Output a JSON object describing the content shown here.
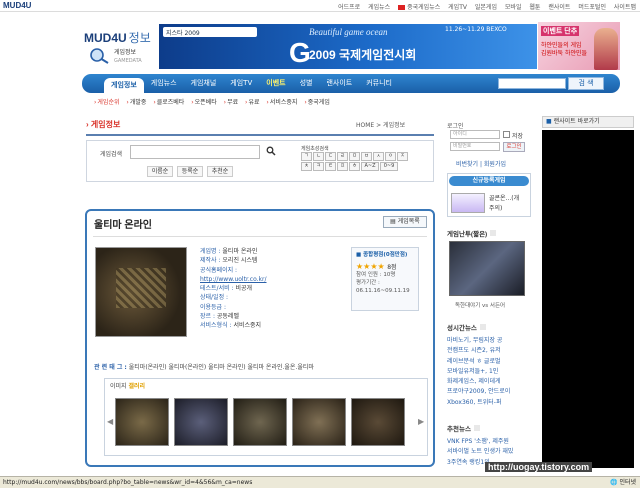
{
  "topbar": {
    "logo": "MUD4U",
    "links": [
      "어드프로",
      "게임뉴스",
      "중국게임뉴스",
      "게임TV",
      "일본게임",
      "모바일",
      "웹툰",
      "랜사이트",
      "머드포털인",
      "사이트맵"
    ]
  },
  "header": {
    "site_title": "MUD4U",
    "site_title_suffix": "정보",
    "game_info_label": "게임정보",
    "game_info_sub": "GAMEDATA"
  },
  "banner": {
    "tag": "지스타 2009",
    "g": "G",
    "year_title": "2009 국제게임전시회",
    "subtitle": "Beautiful game ocean",
    "date": "11.26~11.29  BEXCO"
  },
  "side_ad": {
    "line1": "이벤트 단추",
    "line2": "하얀민들의 게임",
    "line3": "김원바둑 하얀민들"
  },
  "nav": {
    "items": [
      "게임정보",
      "게임뉴스",
      "게임채널",
      "게임TV",
      "이벤트",
      "성별",
      "랜사이트",
      "커뮤니티"
    ],
    "search_button": "검 색"
  },
  "subnav": {
    "items": [
      "게임순위",
      "개발중",
      "클로즈베타",
      "오픈베타",
      "무료",
      "유료",
      "서비스중지",
      "중국게임"
    ]
  },
  "page": {
    "title": "게임정보",
    "breadcrumb": "HOME  >  게임정보"
  },
  "search": {
    "label": "게임검색",
    "sort_buttons": [
      "이름순",
      "등록순",
      "추천순"
    ],
    "initials_label": "게임초성검색",
    "initials": [
      "ㄱ",
      "ㄴ",
      "ㄷ",
      "ㄹ",
      "ㅁ",
      "ㅂ",
      "ㅅ",
      "ㅇ",
      "ㅈ",
      "ㅊ",
      "ㅋ",
      "ㅌ",
      "ㅍ",
      "ㅎ",
      "A~Z",
      "0~9"
    ]
  },
  "game": {
    "name": "울티마 온라인",
    "list_button": "게임목록",
    "fields": [
      {
        "k": "게임명 : ",
        "v": "울티마 온라인"
      },
      {
        "k": "제작사 : ",
        "v": "오리진 시스템"
      },
      {
        "k": "공식홈페이지 : ",
        "v": ""
      },
      {
        "k": "",
        "v": "http://www.uoltr.co.kr/"
      },
      {
        "k": "테스트/서비 : ",
        "v": "비공개"
      },
      {
        "k": "상태/일정 : ",
        "v": ""
      },
      {
        "k": "이용등급 : ",
        "v": ""
      },
      {
        "k": "장르 : ",
        "v": "공동레벨"
      },
      {
        "k": "서비스형식 : ",
        "v": "서비스중지"
      }
    ],
    "rating": {
      "title": "종합평점(0점만점)",
      "stars": "★★★★",
      "score": "8점",
      "line1": "참여 인원 : 10명",
      "line2": "평가기간 :",
      "line3": "06.11.16~09.11.19"
    },
    "tags_label": "관 련 태 그 :",
    "tags": "울티마(온라인)  울티마(온라인) 울티마 온라인)  울티마 온라인.울온.울티마",
    "shots_label": "이미지",
    "shots_label_accent": "갤러리"
  },
  "login": {
    "label": "로그인",
    "id_placeholder": "아이디",
    "pw_placeholder": "비밀번호",
    "save_label": "저장",
    "login_button": "로그인",
    "links": "비번찾기 | 회원가입"
  },
  "new_game": {
    "header": "신규등록게임",
    "line1": "골콘온...(개",
    "line2": "주의)"
  },
  "video": {
    "header": "게임난투(짧은)",
    "caption": "독한대야기 vs 서든어"
  },
  "hot_news": {
    "header": "성시간뉴스",
    "items": [
      "마비노기, 무림지장 공",
      "전캠프도 시즌2, 유저",
      "레이브분석 ㅎ 글로벌",
      "모바일유저들+, 1인",
      "화제게임스, 제이데게",
      "프로야구2009, 안드로이",
      "Xbox360, 트위터-퍼"
    ]
  },
  "rec_news": {
    "header": "추천뉴스",
    "items": [
      "VNK FPS '소잼', 제주원",
      "서바이벌 노트 인생가 재밌",
      "3주연속 랭킹1위 ..."
    ]
  },
  "right_ad": {
    "header": "랜사이트 바로가기"
  },
  "status": {
    "url": "http://mud4u.com/news/bbs/board.php?bo_table=news&wr_id=4&56&m_ca=news",
    "zone": "인터넷",
    "watermark": "http://uogay.tistory.com"
  },
  "colors": {
    "nav_blue": "#1a5fa8",
    "accent_red": "#d9342b",
    "card_border": "#3a78b8"
  }
}
